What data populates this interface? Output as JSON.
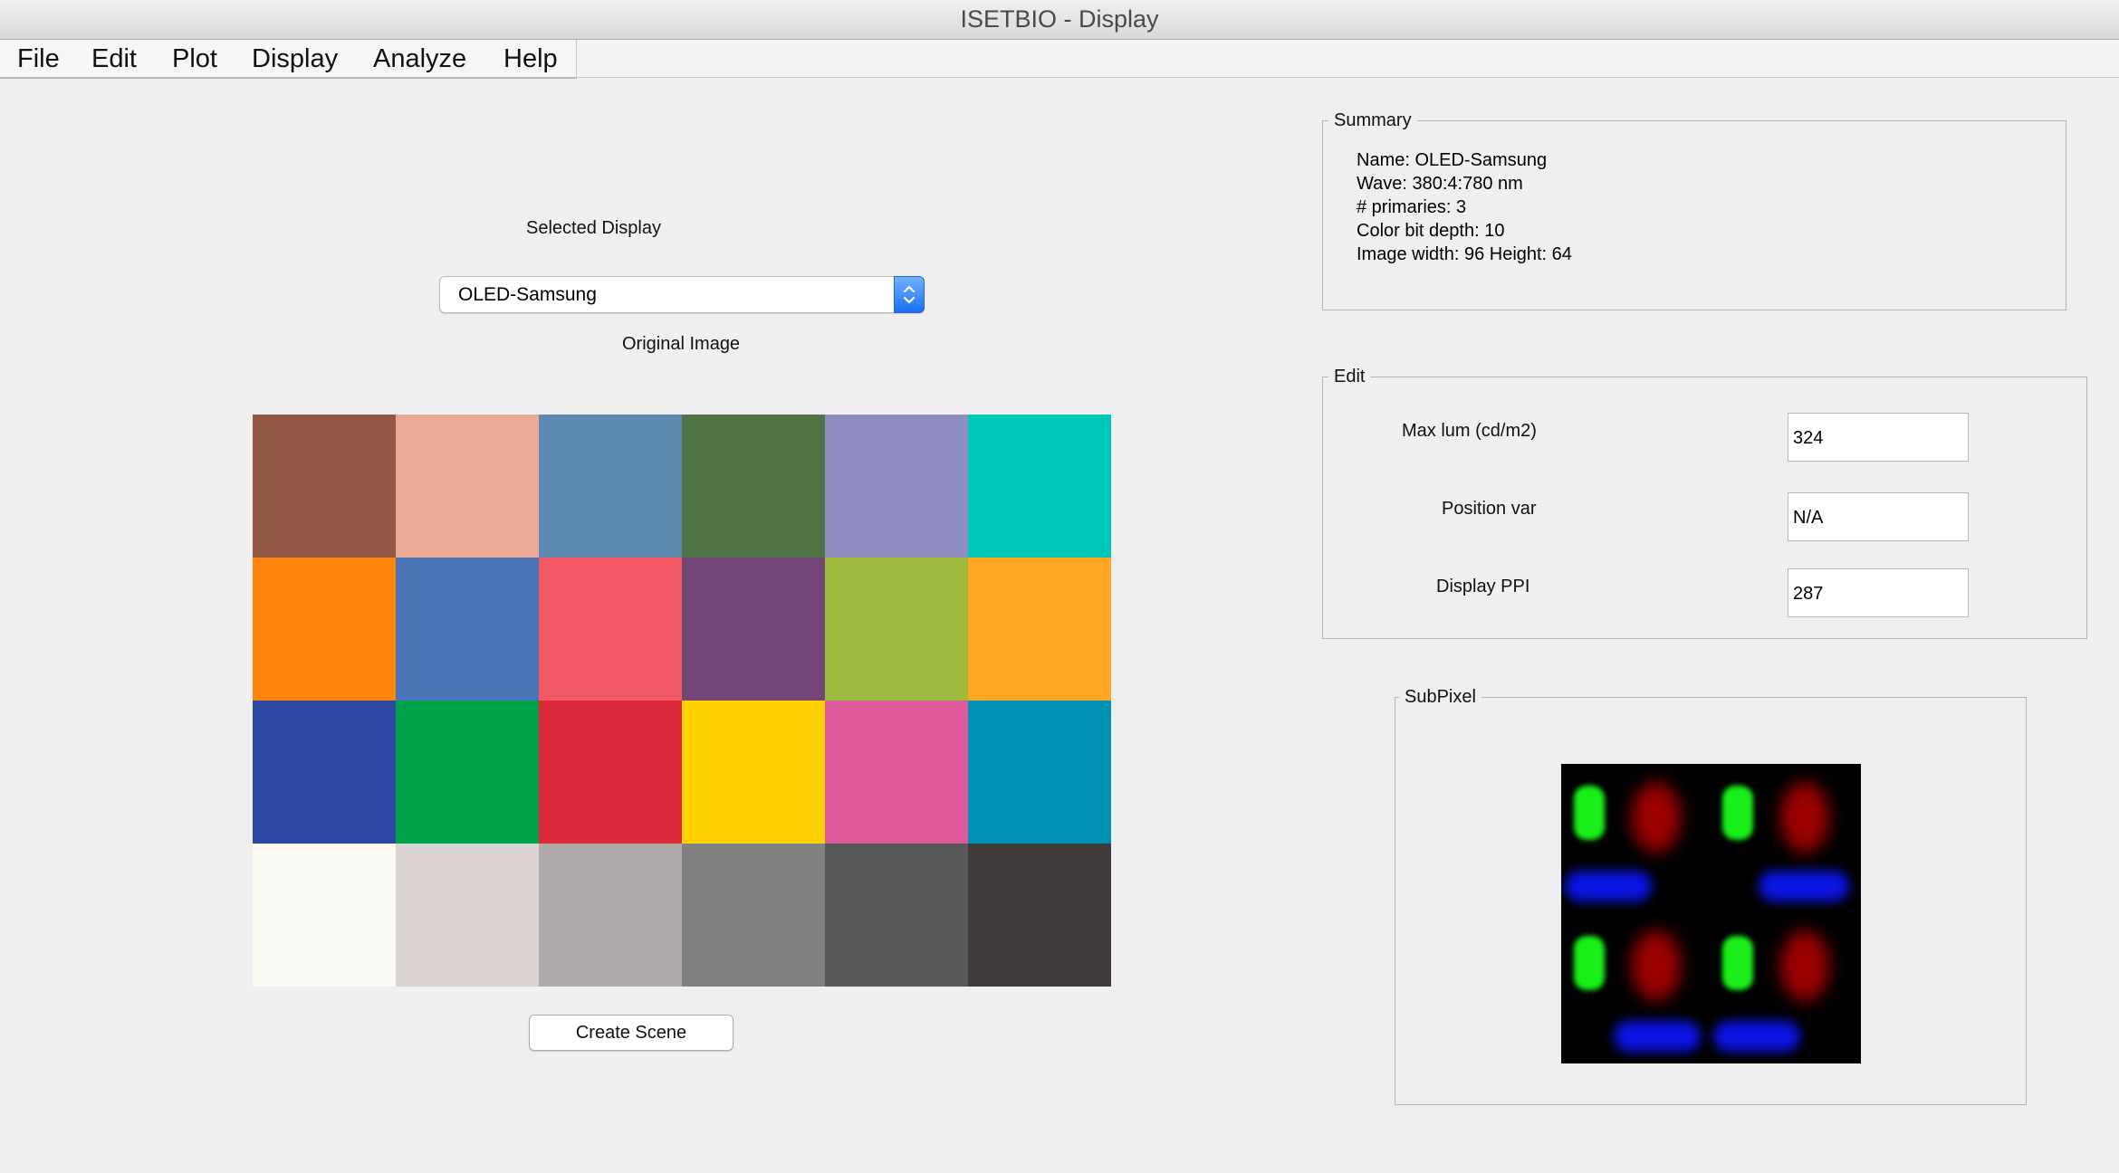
{
  "window": {
    "title": "ISETBIO - Display"
  },
  "menu": [
    "File",
    "Edit",
    "Plot",
    "Display",
    "Analyze",
    "Help"
  ],
  "display_selector": {
    "label": "Selected Display",
    "value": "OLED-Samsung"
  },
  "image_panel": {
    "label": "Original Image",
    "create_button": "Create Scene",
    "patch_colors": [
      "#945945",
      "#eaaa95",
      "#5b89af",
      "#517444",
      "#908ec0",
      "#00c8b8",
      "#ff860c",
      "#4a73b8",
      "#f35965",
      "#734677",
      "#9eba3e",
      "#fea521",
      "#2c48a2",
      "#00a14b",
      "#dd2a3a",
      "#ffd000",
      "#de5a9b",
      "#0092b5",
      "#fbf9f3",
      "#dcd3d3",
      "#afa9a9",
      "#808080",
      "#585858",
      "#3f3b3a"
    ]
  },
  "summary": {
    "title": "Summary",
    "lines": [
      "Name: OLED-Samsung",
      "Wave: 380:4:780 nm",
      "# primaries: 3",
      "Color bit depth: 10",
      "Image width: 96  Height: 64"
    ]
  },
  "edit": {
    "title": "Edit",
    "max_lum_label": "Max lum (cd/m2)",
    "max_lum_value": "324",
    "position_var_label": "Position var",
    "position_var_value": "N/A",
    "ppi_label": "Display PPI",
    "ppi_value": "287"
  },
  "subpixel": {
    "title": "SubPixel"
  }
}
